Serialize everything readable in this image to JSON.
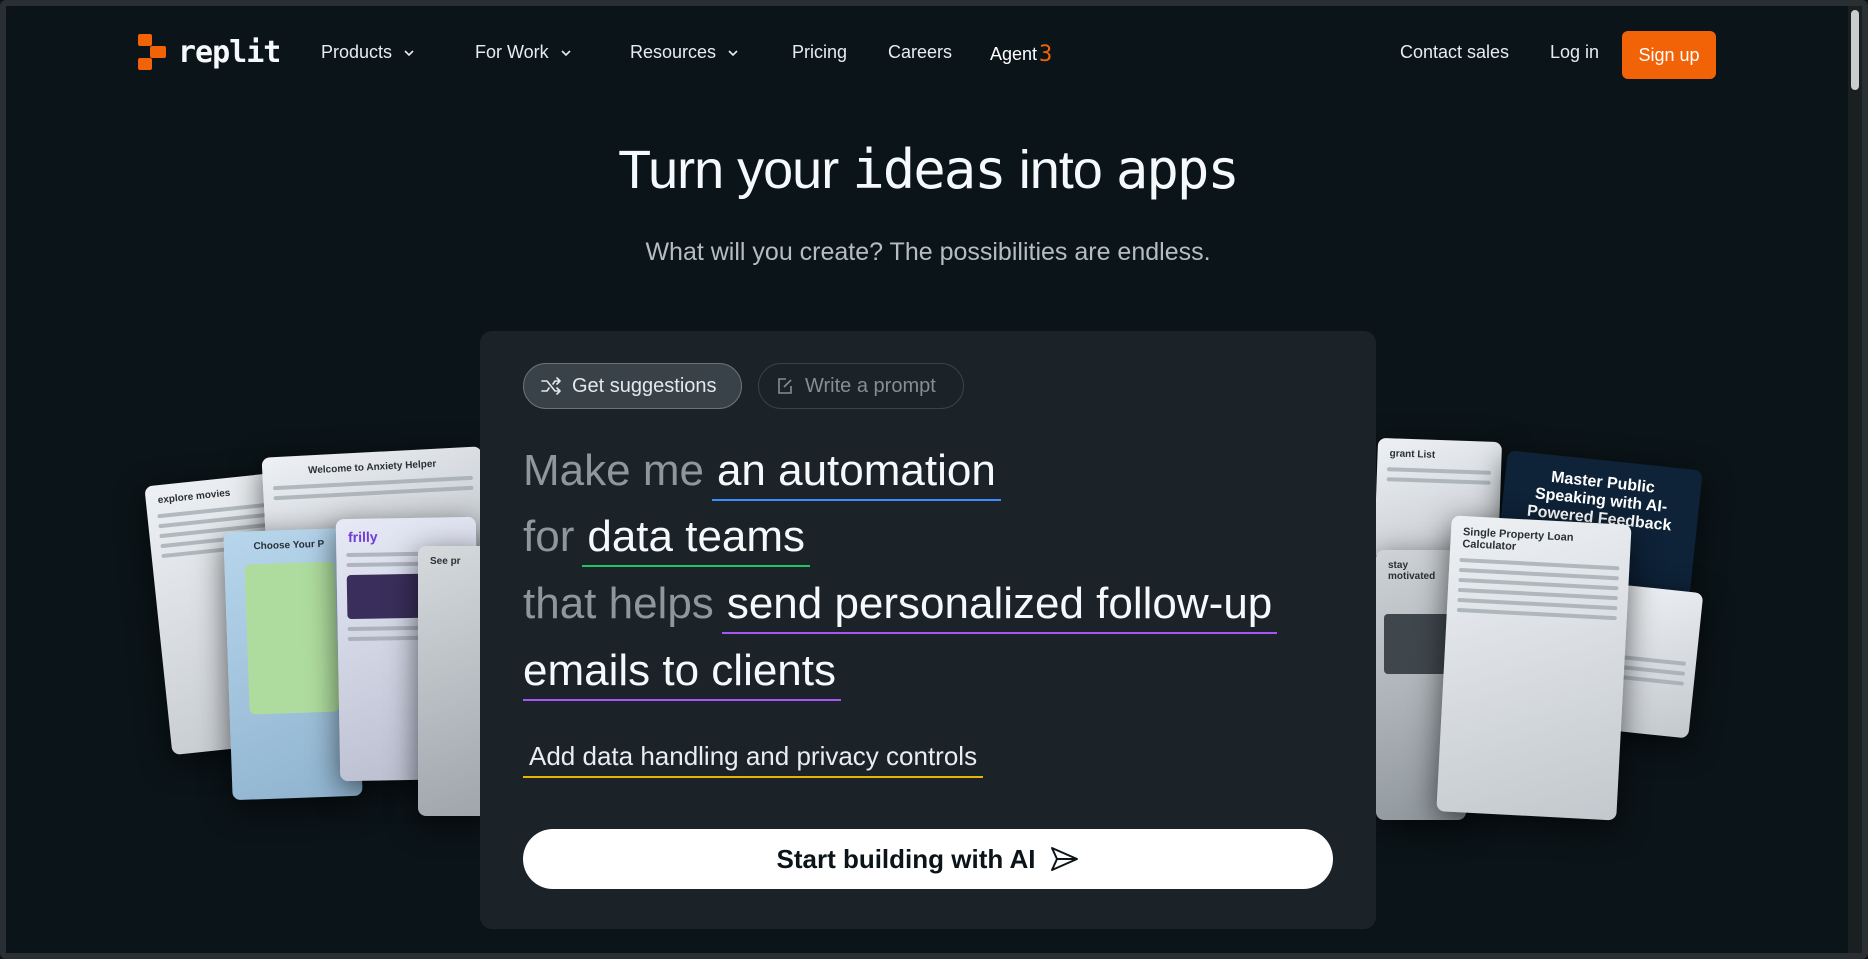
{
  "nav": {
    "logo_text": "replit",
    "items": [
      {
        "label": "Products",
        "has_menu": true
      },
      {
        "label": "For Work",
        "has_menu": true
      },
      {
        "label": "Resources",
        "has_menu": true
      },
      {
        "label": "Pricing",
        "has_menu": false
      },
      {
        "label": "Careers",
        "has_menu": false
      },
      {
        "label": "Agent",
        "badge": "3",
        "has_menu": false
      }
    ],
    "contact_sales": "Contact sales",
    "login": "Log in",
    "signup": "Sign up"
  },
  "hero": {
    "title_part1": "Turn your",
    "title_pixel1": "ideas",
    "title_part2": "into",
    "title_pixel2": "apps",
    "subtitle": "What will you create? The possibilities are endless."
  },
  "panel": {
    "chip_suggestions": "Get suggestions",
    "chip_write": "Write a prompt",
    "line1_static": "Make me",
    "line1_slot": "an automation",
    "line2_static": "for",
    "line2_slot": "data teams",
    "line3_static": "that helps",
    "line3_slot": "send personalized follow-up",
    "line4_slot": "emails to clients",
    "addon": "Add data handling and privacy controls",
    "cta": "Start building with AI"
  },
  "preview_cards": {
    "left": [
      {
        "title": "explore movies"
      },
      {
        "title": "Welcome to Anxiety Helper"
      },
      {
        "title": "Choose Your P"
      },
      {
        "title": "frilly"
      },
      {
        "title": "See pr"
      }
    ],
    "right": [
      {
        "title": "grant List"
      },
      {
        "title": "Master Public Speaking with AI-Powered Feedback"
      },
      {
        "title": "Single Property Loan Calculator"
      },
      {
        "title": "stay motivated"
      }
    ]
  },
  "colors": {
    "brand_orange": "#f26207",
    "background": "#0b1418",
    "panel": "#1c2328",
    "underline_blue": "#3d8bfd",
    "underline_green": "#23c45e",
    "underline_purple": "#a855f7",
    "underline_yellow": "#eab308"
  }
}
